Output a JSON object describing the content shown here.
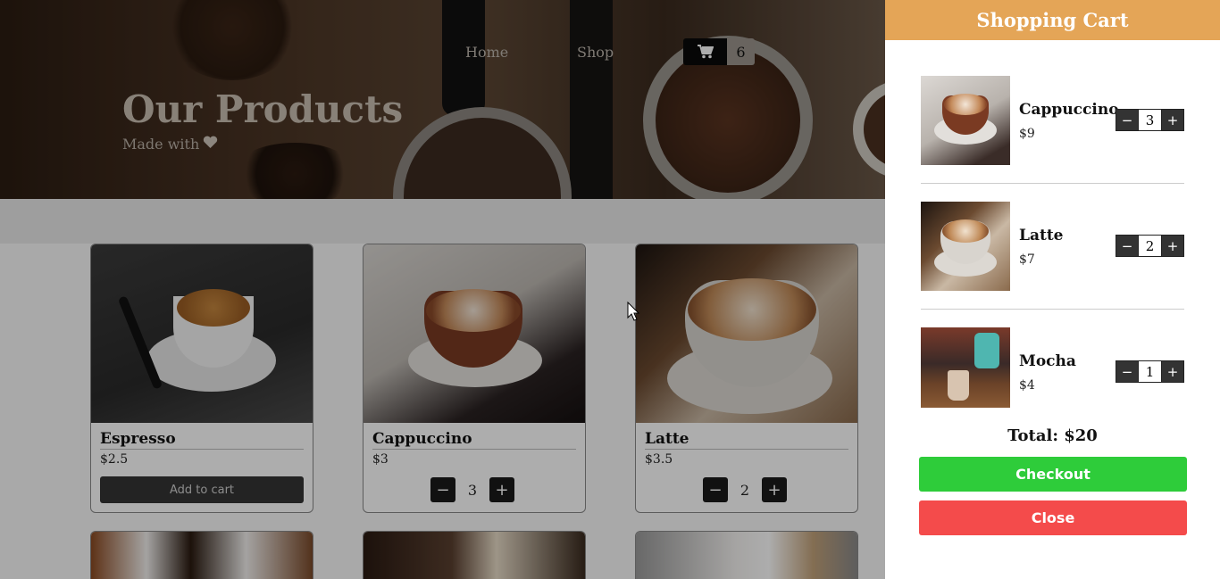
{
  "nav": {
    "home": "Home",
    "shop": "Shop",
    "cart_count": "6"
  },
  "hero": {
    "title": "Our Products",
    "subtitle": "Made with"
  },
  "products": [
    {
      "name": "Espresso",
      "price": "$2.5",
      "action": "Add to cart"
    },
    {
      "name": "Cappuccino",
      "price": "$3",
      "qty": "3"
    },
    {
      "name": "Latte",
      "price": "$3.5",
      "qty": "2"
    }
  ],
  "stepper": {
    "minus": "−",
    "plus": "+"
  },
  "cart": {
    "title": "Shopping Cart",
    "items": [
      {
        "name": "Cappuccino",
        "price": "$9",
        "qty": "3"
      },
      {
        "name": "Latte",
        "price": "$7",
        "qty": "2"
      },
      {
        "name": "Mocha",
        "price": "$4",
        "qty": "1"
      }
    ],
    "total": "Total: $20",
    "checkout": "Checkout",
    "close": "Close"
  },
  "colors": {
    "header": "#e4a557",
    "checkout": "#2ecc3a",
    "close": "#f44b4b"
  },
  "icons": {
    "cart": "cart-icon",
    "heart": "heart-icon"
  }
}
